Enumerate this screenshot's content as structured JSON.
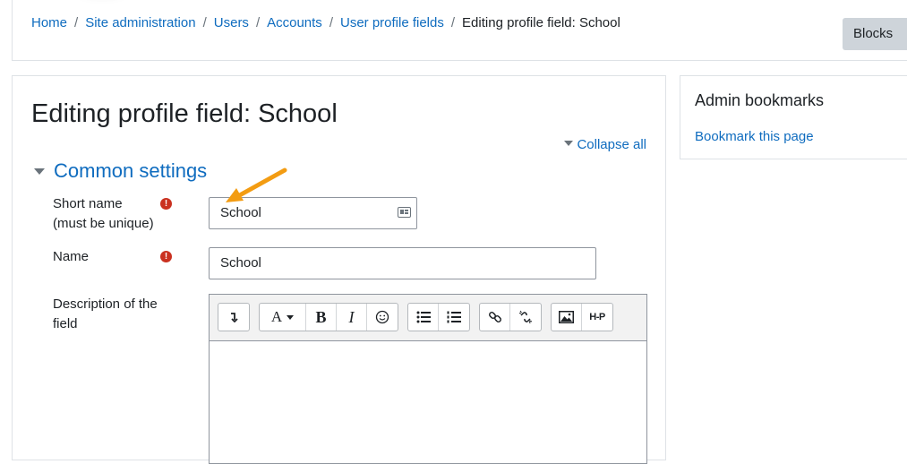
{
  "breadcrumb": [
    {
      "label": "Home"
    },
    {
      "label": "Site administration"
    },
    {
      "label": "Users"
    },
    {
      "label": "Accounts"
    },
    {
      "label": "User profile fields"
    }
  ],
  "breadcrumb_current": "Editing profile field: School",
  "blocks_button": "Blocks",
  "page_title": "Editing profile field: School",
  "collapse_all": "Collapse all",
  "section": {
    "title": "Common settings"
  },
  "fields": {
    "short_name": {
      "label_line1": "Short name",
      "label_line2": "(must be unique)",
      "value": "School"
    },
    "name": {
      "label": "Name",
      "value": "School"
    },
    "description": {
      "label_line1": "Description of the",
      "label_line2": "field"
    }
  },
  "required_icon": "exclamation-circle-icon",
  "editor_toolbar": {
    "font_size": "A",
    "bold": "B",
    "italic": "I",
    "h5p": "H-P"
  },
  "side_block": {
    "title": "Admin bookmarks",
    "link": "Bookmark this page"
  },
  "colors": {
    "link": "#0f6cbf",
    "required": "#ca3120",
    "arrow": "#f39c12"
  }
}
